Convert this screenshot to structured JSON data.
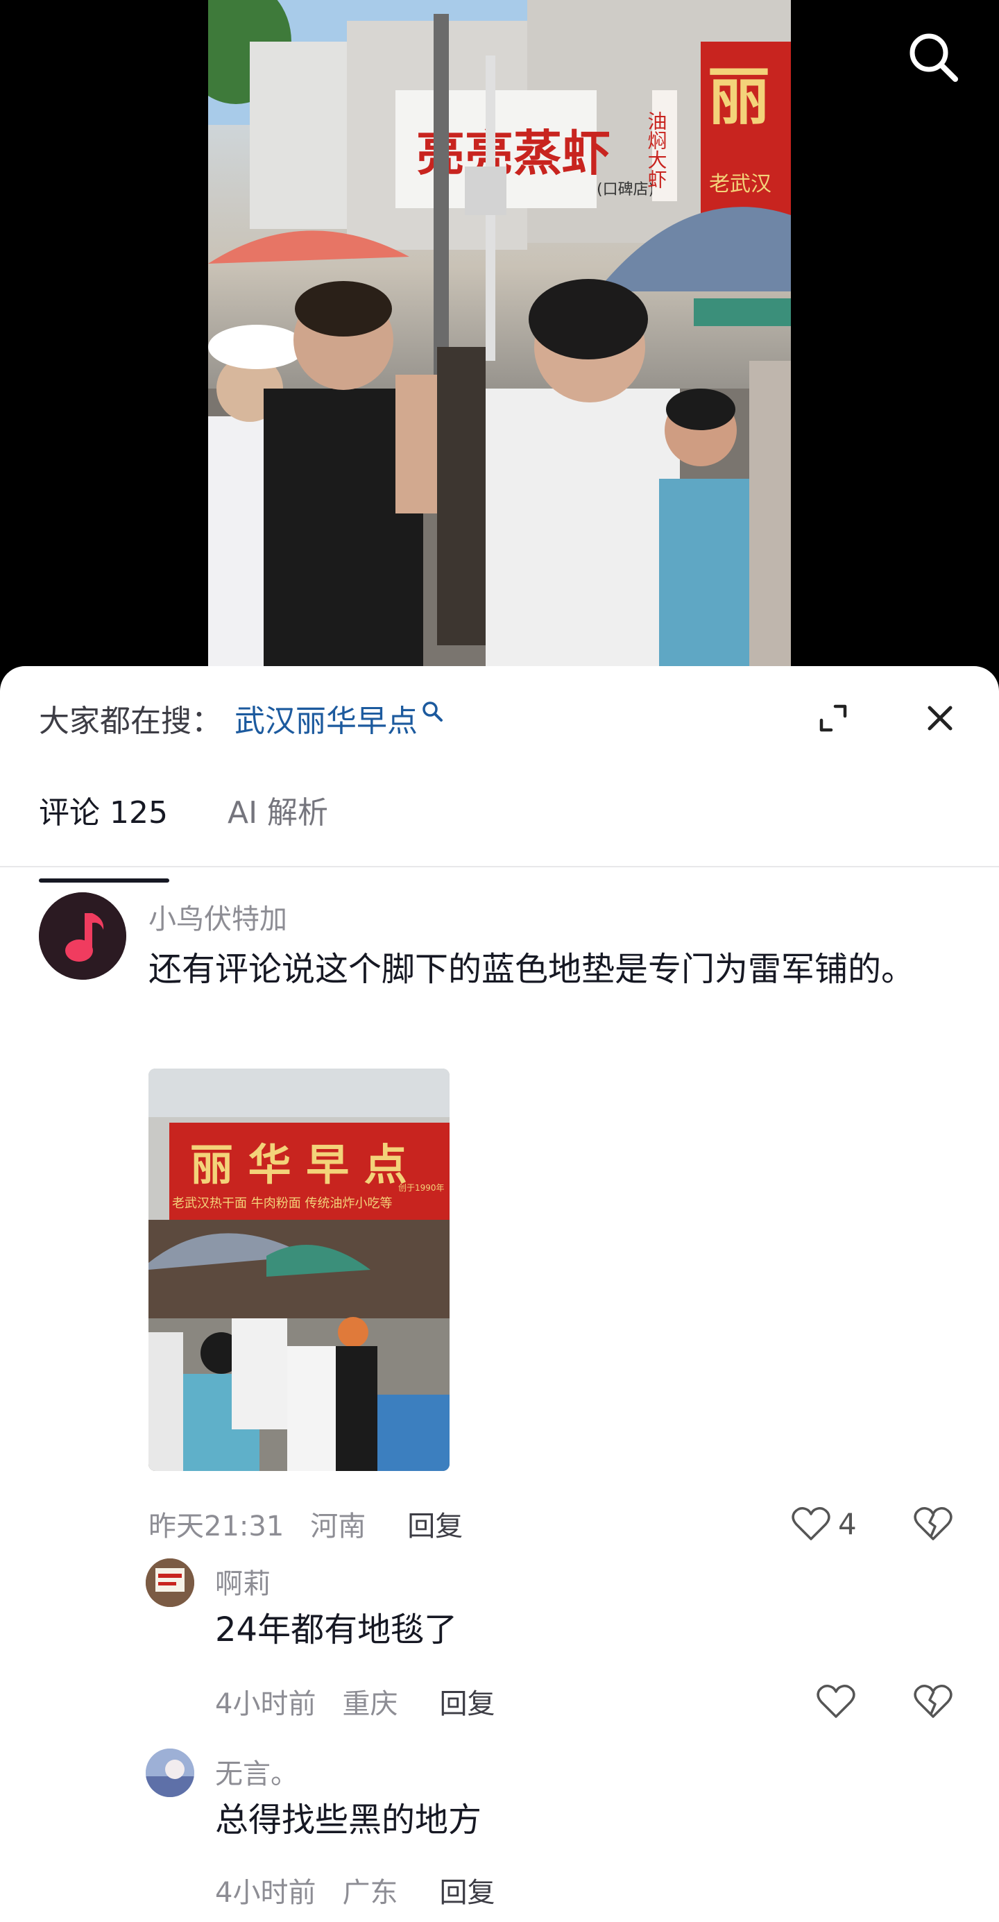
{
  "search": {
    "prefix": "大家都在搜：",
    "term": "武汉丽华早点"
  },
  "tabs": [
    {
      "label": "评论 125",
      "active": true
    },
    {
      "label": "AI 解析",
      "active": false
    }
  ],
  "video": {
    "signs": {
      "shop1": "亮亮蒸虾",
      "shop1_branch": "(口碑店)",
      "shop1_side": "油焖大虾",
      "shop2": "丽",
      "shop2_sub": "老武汉"
    }
  },
  "comments": [
    {
      "author": "小鸟伏特加",
      "text": "还有评论说这个脚下的蓝色地垫是专门为雷军铺的。",
      "time": "昨天21:31",
      "location": "河南",
      "reply": "回复",
      "likes": "4",
      "photo_signs": {
        "title": "丽 华 早 点",
        "subtitle": "老武汉热干面  牛肉粉面  传统油炸小吃等",
        "founded": "创于1990年"
      }
    },
    {
      "author": "啊莉",
      "text": "24年都有地毯了",
      "time": "4小时前",
      "location": "重庆",
      "reply": "回复"
    },
    {
      "author": "无言。",
      "text": "总得找些黑的地方",
      "time": "4小时前",
      "location": "广东",
      "reply": "回复"
    }
  ],
  "colors": {
    "link_blue": "#1c5a9e",
    "sign_red": "#c8241f",
    "sign_gold": "#f3d37a"
  }
}
